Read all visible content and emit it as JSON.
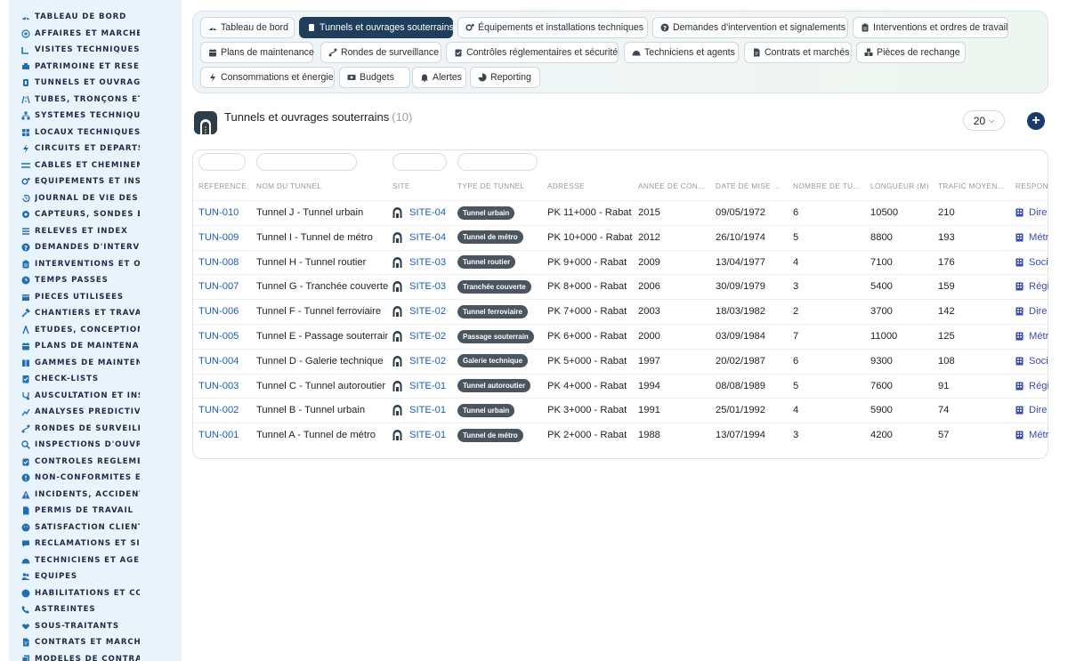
{
  "sidebar": {
    "items": [
      {
        "label": "TABLEAU DE BORD",
        "icon": "dashboard-icon"
      },
      {
        "label": "AFFAIRES ET MARCHÉS",
        "icon": "target-icon"
      },
      {
        "label": "VISITES TECHNIQUES ET",
        "icon": "ruler-icon"
      },
      {
        "label": "PATRIMOINE ET RÉSEAUX",
        "icon": "network-icon"
      },
      {
        "label": "TUNNELS ET OUVRAGES",
        "icon": "tunnel-icon"
      },
      {
        "label": "TUBES, TRONÇONS ET ZO",
        "icon": "road-icon"
      },
      {
        "label": "SYSTÈMES TECHNIQUES",
        "icon": "sitemap-icon"
      },
      {
        "label": "LOCAUX TECHNIQUES ET",
        "icon": "grid-icon"
      },
      {
        "label": "CIRCUITS ET DÉPARTS ÉL",
        "icon": "bolt-icon"
      },
      {
        "label": "CÂBLES ET CHEMINEMENT",
        "icon": "cable-icon"
      },
      {
        "label": "ÉQUIPEMENTS ET INSTAL",
        "icon": "cogs-icon"
      },
      {
        "label": "JOURNAL DE VIE DES ÉQ",
        "icon": "history-icon"
      },
      {
        "label": "CAPTEURS, SONDES ET C",
        "icon": "sensor-icon"
      },
      {
        "label": "RELEVÉS ET INDEX",
        "icon": "list-icon"
      },
      {
        "label": "DEMANDES D'INTERVENT",
        "icon": "question-icon"
      },
      {
        "label": "INTERVENTIONS ET ORDR",
        "icon": "clipboard-icon"
      },
      {
        "label": "TEMPS PASSÉS",
        "icon": "clock-icon"
      },
      {
        "label": "PIÈCES UTILISÉES",
        "icon": "box-icon"
      },
      {
        "label": "CHANTIERS ET TRAVAUX",
        "icon": "hammer-icon"
      },
      {
        "label": "ÉTUDES, CONCEPTION ET",
        "icon": "compass-icon"
      },
      {
        "label": "PLANS DE MAINTENANCE",
        "icon": "calendar-icon"
      },
      {
        "label": "GAMMES DE MAINTENAN",
        "icon": "book-icon"
      },
      {
        "label": "CHECK-LISTS",
        "icon": "checklist-icon"
      },
      {
        "label": "AUSCULTATION ET INSTR",
        "icon": "stethoscope-icon"
      },
      {
        "label": "ANALYSES PRÉDICTIVES",
        "icon": "chart-icon"
      },
      {
        "label": "RONDES DE SURVEILLAN",
        "icon": "route-icon"
      },
      {
        "label": "INSPECTIONS D'OUVRAG",
        "icon": "search-icon"
      },
      {
        "label": "CONTRÔLES RÉGLEMENT",
        "icon": "clipboard-check-icon"
      },
      {
        "label": "NON-CONFORMITÉS ET A",
        "icon": "alert-circle-icon"
      },
      {
        "label": "INCIDENTS, ACCIDENTS E",
        "icon": "warning-icon"
      },
      {
        "label": "PERMIS DE TRAVAIL",
        "icon": "file-icon"
      },
      {
        "label": "SATISFACTION CLIENT",
        "icon": "smile-icon"
      },
      {
        "label": "RÉCLAMATIONS ET SIGNA",
        "icon": "comment-icon"
      },
      {
        "label": "TECHNICIENS ET AGENTS",
        "icon": "hardhat-icon"
      },
      {
        "label": "ÉQUIPES",
        "icon": "users-icon"
      },
      {
        "label": "HABILITATIONS ET COMP",
        "icon": "badge-icon"
      },
      {
        "label": "ASTREINTES",
        "icon": "phone-icon"
      },
      {
        "label": "SOUS-TRAITANTS",
        "icon": "handshake-icon"
      },
      {
        "label": "CONTRATS ET MARCHÉS",
        "icon": "contract-icon"
      },
      {
        "label": "MODÈLES DE CONTRATS",
        "icon": "file-copy-icon"
      }
    ]
  },
  "tabs": [
    {
      "label": "Tableau de bord",
      "icon": "dashboard-icon",
      "active": false
    },
    {
      "label": "Tunnels et ouvrages souterrains",
      "icon": "tunnel-icon",
      "active": true
    },
    {
      "label": "Équipements et installations techniques",
      "icon": "cogs-icon",
      "active": false
    },
    {
      "label": "Demandes d'intervention et signalements",
      "icon": "question-icon",
      "active": false
    },
    {
      "label": "Interventions et ordres de travail",
      "icon": "clipboard-icon",
      "active": false
    },
    {
      "label": "Plans de maintenance",
      "icon": "calendar-icon",
      "active": false
    },
    {
      "label": "Rondes de surveillance",
      "icon": "route-icon",
      "active": false
    },
    {
      "label": "Contrôles réglementaires et sécurité",
      "icon": "clipboard-check-icon",
      "active": false
    },
    {
      "label": "Techniciens et agents",
      "icon": "hardhat-icon",
      "active": false
    },
    {
      "label": "Contrats et marchés",
      "icon": "contract-icon",
      "active": false
    },
    {
      "label": "Pièces de rechange",
      "icon": "boxes-icon",
      "active": false
    },
    {
      "label": "Consommations et énergie",
      "icon": "bolt-icon",
      "active": false
    },
    {
      "label": "Budgets",
      "icon": "money-icon",
      "active": false
    },
    {
      "label": "Alertes",
      "icon": "bell-icon",
      "active": false
    },
    {
      "label": "Reporting",
      "icon": "pie-icon",
      "active": false
    }
  ],
  "header": {
    "title": "Tunnels et ouvrages souterrains",
    "count": "(10)",
    "page_size": "20"
  },
  "table": {
    "columns": [
      "RÉFÉRENCE",
      "NOM DU TUNNEL",
      "SITE",
      "TYPE DE TUNNEL",
      "ADRESSE",
      "ANNÉE DE CON…",
      "DATE DE MISE …",
      "NOMBRE DE TU…",
      "LONGUEUR (M)",
      "TRAFIC MOYEN…",
      "RESPON"
    ],
    "rows": [
      {
        "ref": "TUN-010",
        "name": "Tunnel J - Tunnel urbain",
        "site": "SITE-04",
        "type": "Tunnel urbain",
        "address": "PK 11+000 - Rabat",
        "year": "2015",
        "date": "09/05/1972",
        "tubes": "6",
        "length": "10500",
        "traffic": "210",
        "resp": "Dire"
      },
      {
        "ref": "TUN-009",
        "name": "Tunnel I - Tunnel de métro",
        "site": "SITE-04",
        "type": "Tunnel de métro",
        "address": "PK 10+000 - Rabat",
        "year": "2012",
        "date": "26/10/1974",
        "tubes": "5",
        "length": "8800",
        "traffic": "193",
        "resp": "Métr"
      },
      {
        "ref": "TUN-008",
        "name": "Tunnel H - Tunnel routier",
        "site": "SITE-03",
        "type": "Tunnel routier",
        "address": "PK 9+000 - Rabat",
        "year": "2009",
        "date": "13/04/1977",
        "tubes": "4",
        "length": "7100",
        "traffic": "176",
        "resp": "Soci"
      },
      {
        "ref": "TUN-007",
        "name": "Tunnel G - Tranchée couverte",
        "site": "SITE-03",
        "type": "Tranchée couverte",
        "address": "PK 8+000 - Rabat",
        "year": "2006",
        "date": "30/09/1979",
        "tubes": "3",
        "length": "5400",
        "traffic": "159",
        "resp": "Régi"
      },
      {
        "ref": "TUN-006",
        "name": "Tunnel F - Tunnel ferroviaire",
        "site": "SITE-02",
        "type": "Tunnel ferroviaire",
        "address": "PK 7+000 - Rabat",
        "year": "2003",
        "date": "18/03/1982",
        "tubes": "2",
        "length": "3700",
        "traffic": "142",
        "resp": "Dire"
      },
      {
        "ref": "TUN-005",
        "name": "Tunnel E - Passage souterrain",
        "site": "SITE-02",
        "type": "Passage souterrain",
        "address": "PK 6+000 - Rabat",
        "year": "2000",
        "date": "03/09/1984",
        "tubes": "7",
        "length": "11000",
        "traffic": "125",
        "resp": "Métr"
      },
      {
        "ref": "TUN-004",
        "name": "Tunnel D - Galerie technique",
        "site": "SITE-02",
        "type": "Galerie technique",
        "address": "PK 5+000 - Rabat",
        "year": "1997",
        "date": "20/02/1987",
        "tubes": "6",
        "length": "9300",
        "traffic": "108",
        "resp": "Soci"
      },
      {
        "ref": "TUN-003",
        "name": "Tunnel C - Tunnel autoroutier",
        "site": "SITE-01",
        "type": "Tunnel autoroutier",
        "address": "PK 4+000 - Rabat",
        "year": "1994",
        "date": "08/08/1989",
        "tubes": "5",
        "length": "7600",
        "traffic": "91",
        "resp": "Régi"
      },
      {
        "ref": "TUN-002",
        "name": "Tunnel B - Tunnel urbain",
        "site": "SITE-01",
        "type": "Tunnel urbain",
        "address": "PK 3+000 - Rabat",
        "year": "1991",
        "date": "25/01/1992",
        "tubes": "4",
        "length": "5900",
        "traffic": "74",
        "resp": "Dire"
      },
      {
        "ref": "TUN-001",
        "name": "Tunnel A - Tunnel de métro",
        "site": "SITE-01",
        "type": "Tunnel de métro",
        "address": "PK 2+000 - Rabat",
        "year": "1988",
        "date": "13/07/1994",
        "tubes": "3",
        "length": "4200",
        "traffic": "57",
        "resp": "Métr"
      }
    ]
  },
  "colors": {
    "sidebar_bg": "#e8f3fb",
    "active_tab": "#1f3e5c",
    "link": "#1a5fb4",
    "badge": "#4a5560",
    "add_button": "#1b3a6b"
  }
}
